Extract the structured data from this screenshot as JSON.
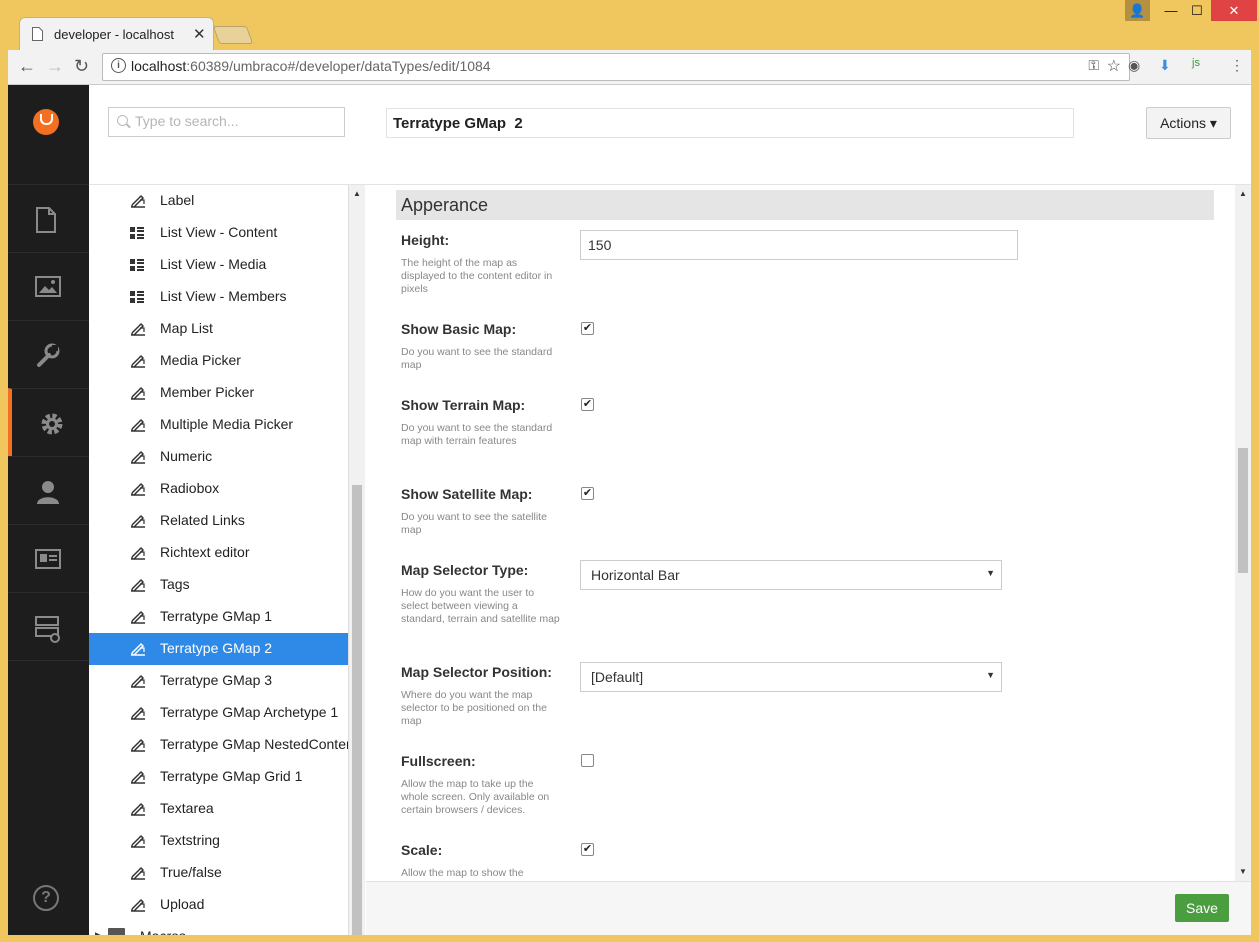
{
  "browser": {
    "tab_title": "developer - localhost",
    "url_host": "localhost",
    "url_rest": ":60389/umbraco#/developer/dataTypes/edit/1084"
  },
  "tree": {
    "search_placeholder": "Type to search...",
    "items": [
      {
        "label": "Label",
        "icon": "datatype-icon"
      },
      {
        "label": "List View - Content",
        "icon": "list-icon"
      },
      {
        "label": "List View - Media",
        "icon": "list-icon"
      },
      {
        "label": "List View - Members",
        "icon": "list-icon"
      },
      {
        "label": "Map List",
        "icon": "datatype-icon"
      },
      {
        "label": "Media Picker",
        "icon": "datatype-icon"
      },
      {
        "label": "Member Picker",
        "icon": "datatype-icon"
      },
      {
        "label": "Multiple Media Picker",
        "icon": "datatype-icon"
      },
      {
        "label": "Numeric",
        "icon": "datatype-icon"
      },
      {
        "label": "Radiobox",
        "icon": "datatype-icon"
      },
      {
        "label": "Related Links",
        "icon": "datatype-icon"
      },
      {
        "label": "Richtext editor",
        "icon": "datatype-icon"
      },
      {
        "label": "Tags",
        "icon": "datatype-icon"
      },
      {
        "label": "Terratype GMap 1",
        "icon": "datatype-icon"
      },
      {
        "label": "Terratype GMap 2",
        "icon": "datatype-icon"
      },
      {
        "label": "Terratype GMap 3",
        "icon": "datatype-icon"
      },
      {
        "label": "Terratype GMap Archetype 1",
        "icon": "datatype-icon"
      },
      {
        "label": "Terratype GMap NestedContent",
        "icon": "datatype-icon"
      },
      {
        "label": "Terratype GMap Grid 1",
        "icon": "datatype-icon"
      },
      {
        "label": "Textarea",
        "icon": "datatype-icon"
      },
      {
        "label": "Textstring",
        "icon": "datatype-icon"
      },
      {
        "label": "True/false",
        "icon": "datatype-icon"
      },
      {
        "label": "Upload",
        "icon": "datatype-icon"
      }
    ],
    "selected_index": 14,
    "macros_label": "Macros"
  },
  "editor": {
    "name": "Terratype GMap  2",
    "actions_label": "Actions",
    "section_title": "Apperance",
    "height": {
      "label": "Height:",
      "desc": "The height of the map as displayed to the content editor in pixels",
      "value": "150"
    },
    "basic": {
      "label": "Show Basic Map:",
      "desc": "Do you want to see the standard map",
      "checked": true
    },
    "terrain": {
      "label": "Show Terrain Map:",
      "desc": "Do you want to see the standard map with terrain features",
      "checked": true
    },
    "satellite": {
      "label": "Show Satellite Map:",
      "desc": "Do you want to see the satellite map",
      "checked": true
    },
    "selector_type": {
      "label": "Map Selector Type:",
      "desc": "How do you want the user to select between viewing a standard, terrain and satellite map",
      "value": "Horizontal Bar"
    },
    "selector_pos": {
      "label": "Map Selector Position:",
      "desc": "Where do you want the map selector to be positioned on the map",
      "value": "[Default]"
    },
    "fullscreen": {
      "label": "Fullscreen:",
      "desc": "Allow the map to take up the whole screen. Only available on certain browsers / devices.",
      "checked": false
    },
    "scale": {
      "label": "Scale:",
      "desc": "Allow the map to show the",
      "checked": true
    },
    "save_label": "Save"
  }
}
